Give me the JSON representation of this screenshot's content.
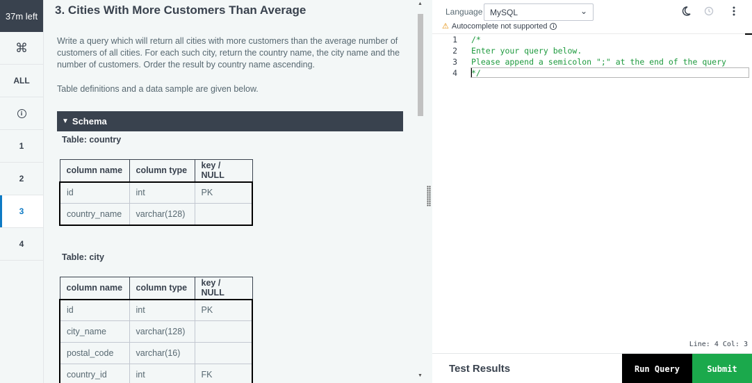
{
  "nav": {
    "timer": "37m left",
    "cmd_icon": "⌘",
    "all_label": "ALL",
    "items": [
      "1",
      "2",
      "3",
      "4"
    ],
    "active": "3"
  },
  "problem": {
    "title": "3. Cities With More Customers Than Average",
    "description": "Write a query which will return all cities with more customers than the average number of customers of all cities. For each such city, return the country name, the city name and the number of customers. Order the result by country name ascending.",
    "note": "Table definitions and a data sample are given below.",
    "schema_label": "Schema",
    "headers": [
      "column name",
      "column type",
      "key / NULL"
    ],
    "tables": [
      {
        "label": "Table: country",
        "rows": [
          [
            "id",
            "int",
            "PK"
          ],
          [
            "country_name",
            "varchar(128)",
            ""
          ]
        ]
      },
      {
        "label": "Table: city",
        "rows": [
          [
            "id",
            "int",
            "PK"
          ],
          [
            "city_name",
            "varchar(128)",
            ""
          ],
          [
            "postal_code",
            "varchar(16)",
            ""
          ],
          [
            "country_id",
            "int",
            "FK"
          ]
        ]
      }
    ]
  },
  "editor": {
    "language_label": "Language",
    "language_value": "MySQL",
    "autocomplete_warning": "Autocomplete not supported",
    "code_lines": [
      "/*",
      "Enter your query below.",
      "Please append a semicolon \";\" at the end of the query",
      "*/"
    ],
    "status": "Line: 4 Col: 3",
    "test_results_label": "Test Results",
    "run_label": "Run Query",
    "submit_label": "Submit"
  },
  "colors": {
    "dark": "#39424e",
    "accent_green": "#1ba94c",
    "active_blue": "#0e7ac4",
    "panel_bg": "#f3f7f7",
    "code_green": "#1e9a3e"
  }
}
